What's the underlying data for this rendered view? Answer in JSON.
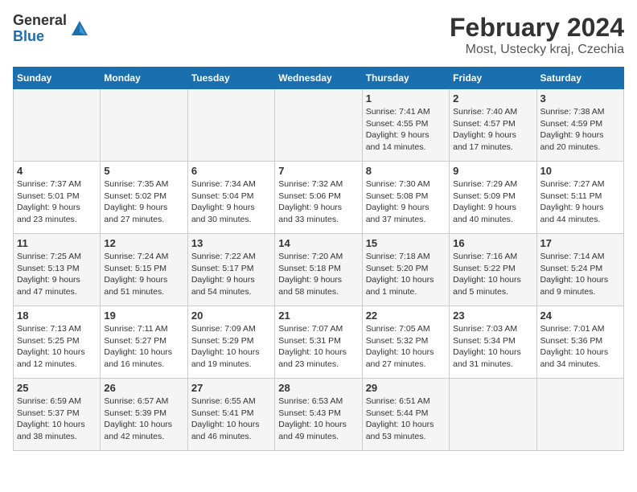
{
  "logo": {
    "general": "General",
    "blue": "Blue"
  },
  "title": {
    "month": "February 2024",
    "location": "Most, Ustecky kraj, Czechia"
  },
  "calendar": {
    "headers": [
      "Sunday",
      "Monday",
      "Tuesday",
      "Wednesday",
      "Thursday",
      "Friday",
      "Saturday"
    ],
    "weeks": [
      [
        {
          "day": "",
          "info": ""
        },
        {
          "day": "",
          "info": ""
        },
        {
          "day": "",
          "info": ""
        },
        {
          "day": "",
          "info": ""
        },
        {
          "day": "1",
          "info": "Sunrise: 7:41 AM\nSunset: 4:55 PM\nDaylight: 9 hours\nand 14 minutes."
        },
        {
          "day": "2",
          "info": "Sunrise: 7:40 AM\nSunset: 4:57 PM\nDaylight: 9 hours\nand 17 minutes."
        },
        {
          "day": "3",
          "info": "Sunrise: 7:38 AM\nSunset: 4:59 PM\nDaylight: 9 hours\nand 20 minutes."
        }
      ],
      [
        {
          "day": "4",
          "info": "Sunrise: 7:37 AM\nSunset: 5:01 PM\nDaylight: 9 hours\nand 23 minutes."
        },
        {
          "day": "5",
          "info": "Sunrise: 7:35 AM\nSunset: 5:02 PM\nDaylight: 9 hours\nand 27 minutes."
        },
        {
          "day": "6",
          "info": "Sunrise: 7:34 AM\nSunset: 5:04 PM\nDaylight: 9 hours\nand 30 minutes."
        },
        {
          "day": "7",
          "info": "Sunrise: 7:32 AM\nSunset: 5:06 PM\nDaylight: 9 hours\nand 33 minutes."
        },
        {
          "day": "8",
          "info": "Sunrise: 7:30 AM\nSunset: 5:08 PM\nDaylight: 9 hours\nand 37 minutes."
        },
        {
          "day": "9",
          "info": "Sunrise: 7:29 AM\nSunset: 5:09 PM\nDaylight: 9 hours\nand 40 minutes."
        },
        {
          "day": "10",
          "info": "Sunrise: 7:27 AM\nSunset: 5:11 PM\nDaylight: 9 hours\nand 44 minutes."
        }
      ],
      [
        {
          "day": "11",
          "info": "Sunrise: 7:25 AM\nSunset: 5:13 PM\nDaylight: 9 hours\nand 47 minutes."
        },
        {
          "day": "12",
          "info": "Sunrise: 7:24 AM\nSunset: 5:15 PM\nDaylight: 9 hours\nand 51 minutes."
        },
        {
          "day": "13",
          "info": "Sunrise: 7:22 AM\nSunset: 5:17 PM\nDaylight: 9 hours\nand 54 minutes."
        },
        {
          "day": "14",
          "info": "Sunrise: 7:20 AM\nSunset: 5:18 PM\nDaylight: 9 hours\nand 58 minutes."
        },
        {
          "day": "15",
          "info": "Sunrise: 7:18 AM\nSunset: 5:20 PM\nDaylight: 10 hours\nand 1 minute."
        },
        {
          "day": "16",
          "info": "Sunrise: 7:16 AM\nSunset: 5:22 PM\nDaylight: 10 hours\nand 5 minutes."
        },
        {
          "day": "17",
          "info": "Sunrise: 7:14 AM\nSunset: 5:24 PM\nDaylight: 10 hours\nand 9 minutes."
        }
      ],
      [
        {
          "day": "18",
          "info": "Sunrise: 7:13 AM\nSunset: 5:25 PM\nDaylight: 10 hours\nand 12 minutes."
        },
        {
          "day": "19",
          "info": "Sunrise: 7:11 AM\nSunset: 5:27 PM\nDaylight: 10 hours\nand 16 minutes."
        },
        {
          "day": "20",
          "info": "Sunrise: 7:09 AM\nSunset: 5:29 PM\nDaylight: 10 hours\nand 19 minutes."
        },
        {
          "day": "21",
          "info": "Sunrise: 7:07 AM\nSunset: 5:31 PM\nDaylight: 10 hours\nand 23 minutes."
        },
        {
          "day": "22",
          "info": "Sunrise: 7:05 AM\nSunset: 5:32 PM\nDaylight: 10 hours\nand 27 minutes."
        },
        {
          "day": "23",
          "info": "Sunrise: 7:03 AM\nSunset: 5:34 PM\nDaylight: 10 hours\nand 31 minutes."
        },
        {
          "day": "24",
          "info": "Sunrise: 7:01 AM\nSunset: 5:36 PM\nDaylight: 10 hours\nand 34 minutes."
        }
      ],
      [
        {
          "day": "25",
          "info": "Sunrise: 6:59 AM\nSunset: 5:37 PM\nDaylight: 10 hours\nand 38 minutes."
        },
        {
          "day": "26",
          "info": "Sunrise: 6:57 AM\nSunset: 5:39 PM\nDaylight: 10 hours\nand 42 minutes."
        },
        {
          "day": "27",
          "info": "Sunrise: 6:55 AM\nSunset: 5:41 PM\nDaylight: 10 hours\nand 46 minutes."
        },
        {
          "day": "28",
          "info": "Sunrise: 6:53 AM\nSunset: 5:43 PM\nDaylight: 10 hours\nand 49 minutes."
        },
        {
          "day": "29",
          "info": "Sunrise: 6:51 AM\nSunset: 5:44 PM\nDaylight: 10 hours\nand 53 minutes."
        },
        {
          "day": "",
          "info": ""
        },
        {
          "day": "",
          "info": ""
        }
      ]
    ]
  }
}
